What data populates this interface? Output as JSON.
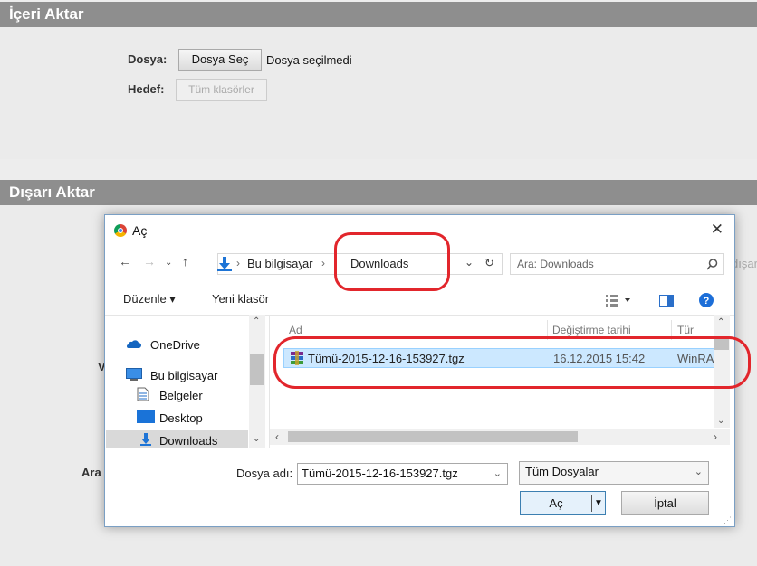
{
  "import_panel": {
    "title": "İçeri Aktar",
    "file_label": "Dosya:",
    "choose_button": "Dosya Seç",
    "no_file_text": "Dosya seçilmedi",
    "target_label": "Hedef:",
    "target_button": "Tüm klasörler"
  },
  "export_panel": {
    "title": "Dışarı Aktar",
    "side_text_right": "dışar",
    "label_a": "V",
    "label_b": "Ara"
  },
  "dialog": {
    "title": "Aç",
    "close_glyph": "✕",
    "address": {
      "crumb1": "Bu bilgisayar",
      "crumb2": "Downloads"
    },
    "search_placeholder": "Ara: Downloads",
    "toolbar": {
      "organize": "Düzenle ▾",
      "new_folder": "Yeni klasör"
    },
    "nav_items": [
      "OneDrive",
      "Bu bilgisayar",
      "Belgeler",
      "Desktop",
      "Downloads"
    ],
    "columns": {
      "name": "Ad",
      "modified": "Değiştirme tarihi",
      "type": "Tür"
    },
    "files": [
      {
        "name": "Tümü-2015-12-16-153927.tgz",
        "modified": "16.12.2015 15:42",
        "type": "WinRA"
      }
    ],
    "filename_label": "Dosya adı:",
    "filename_value": "Tümü-2015-12-16-153927.tgz",
    "filter_value": "Tüm Dosyalar",
    "open_button": "Aç",
    "cancel_button": "İptal"
  }
}
